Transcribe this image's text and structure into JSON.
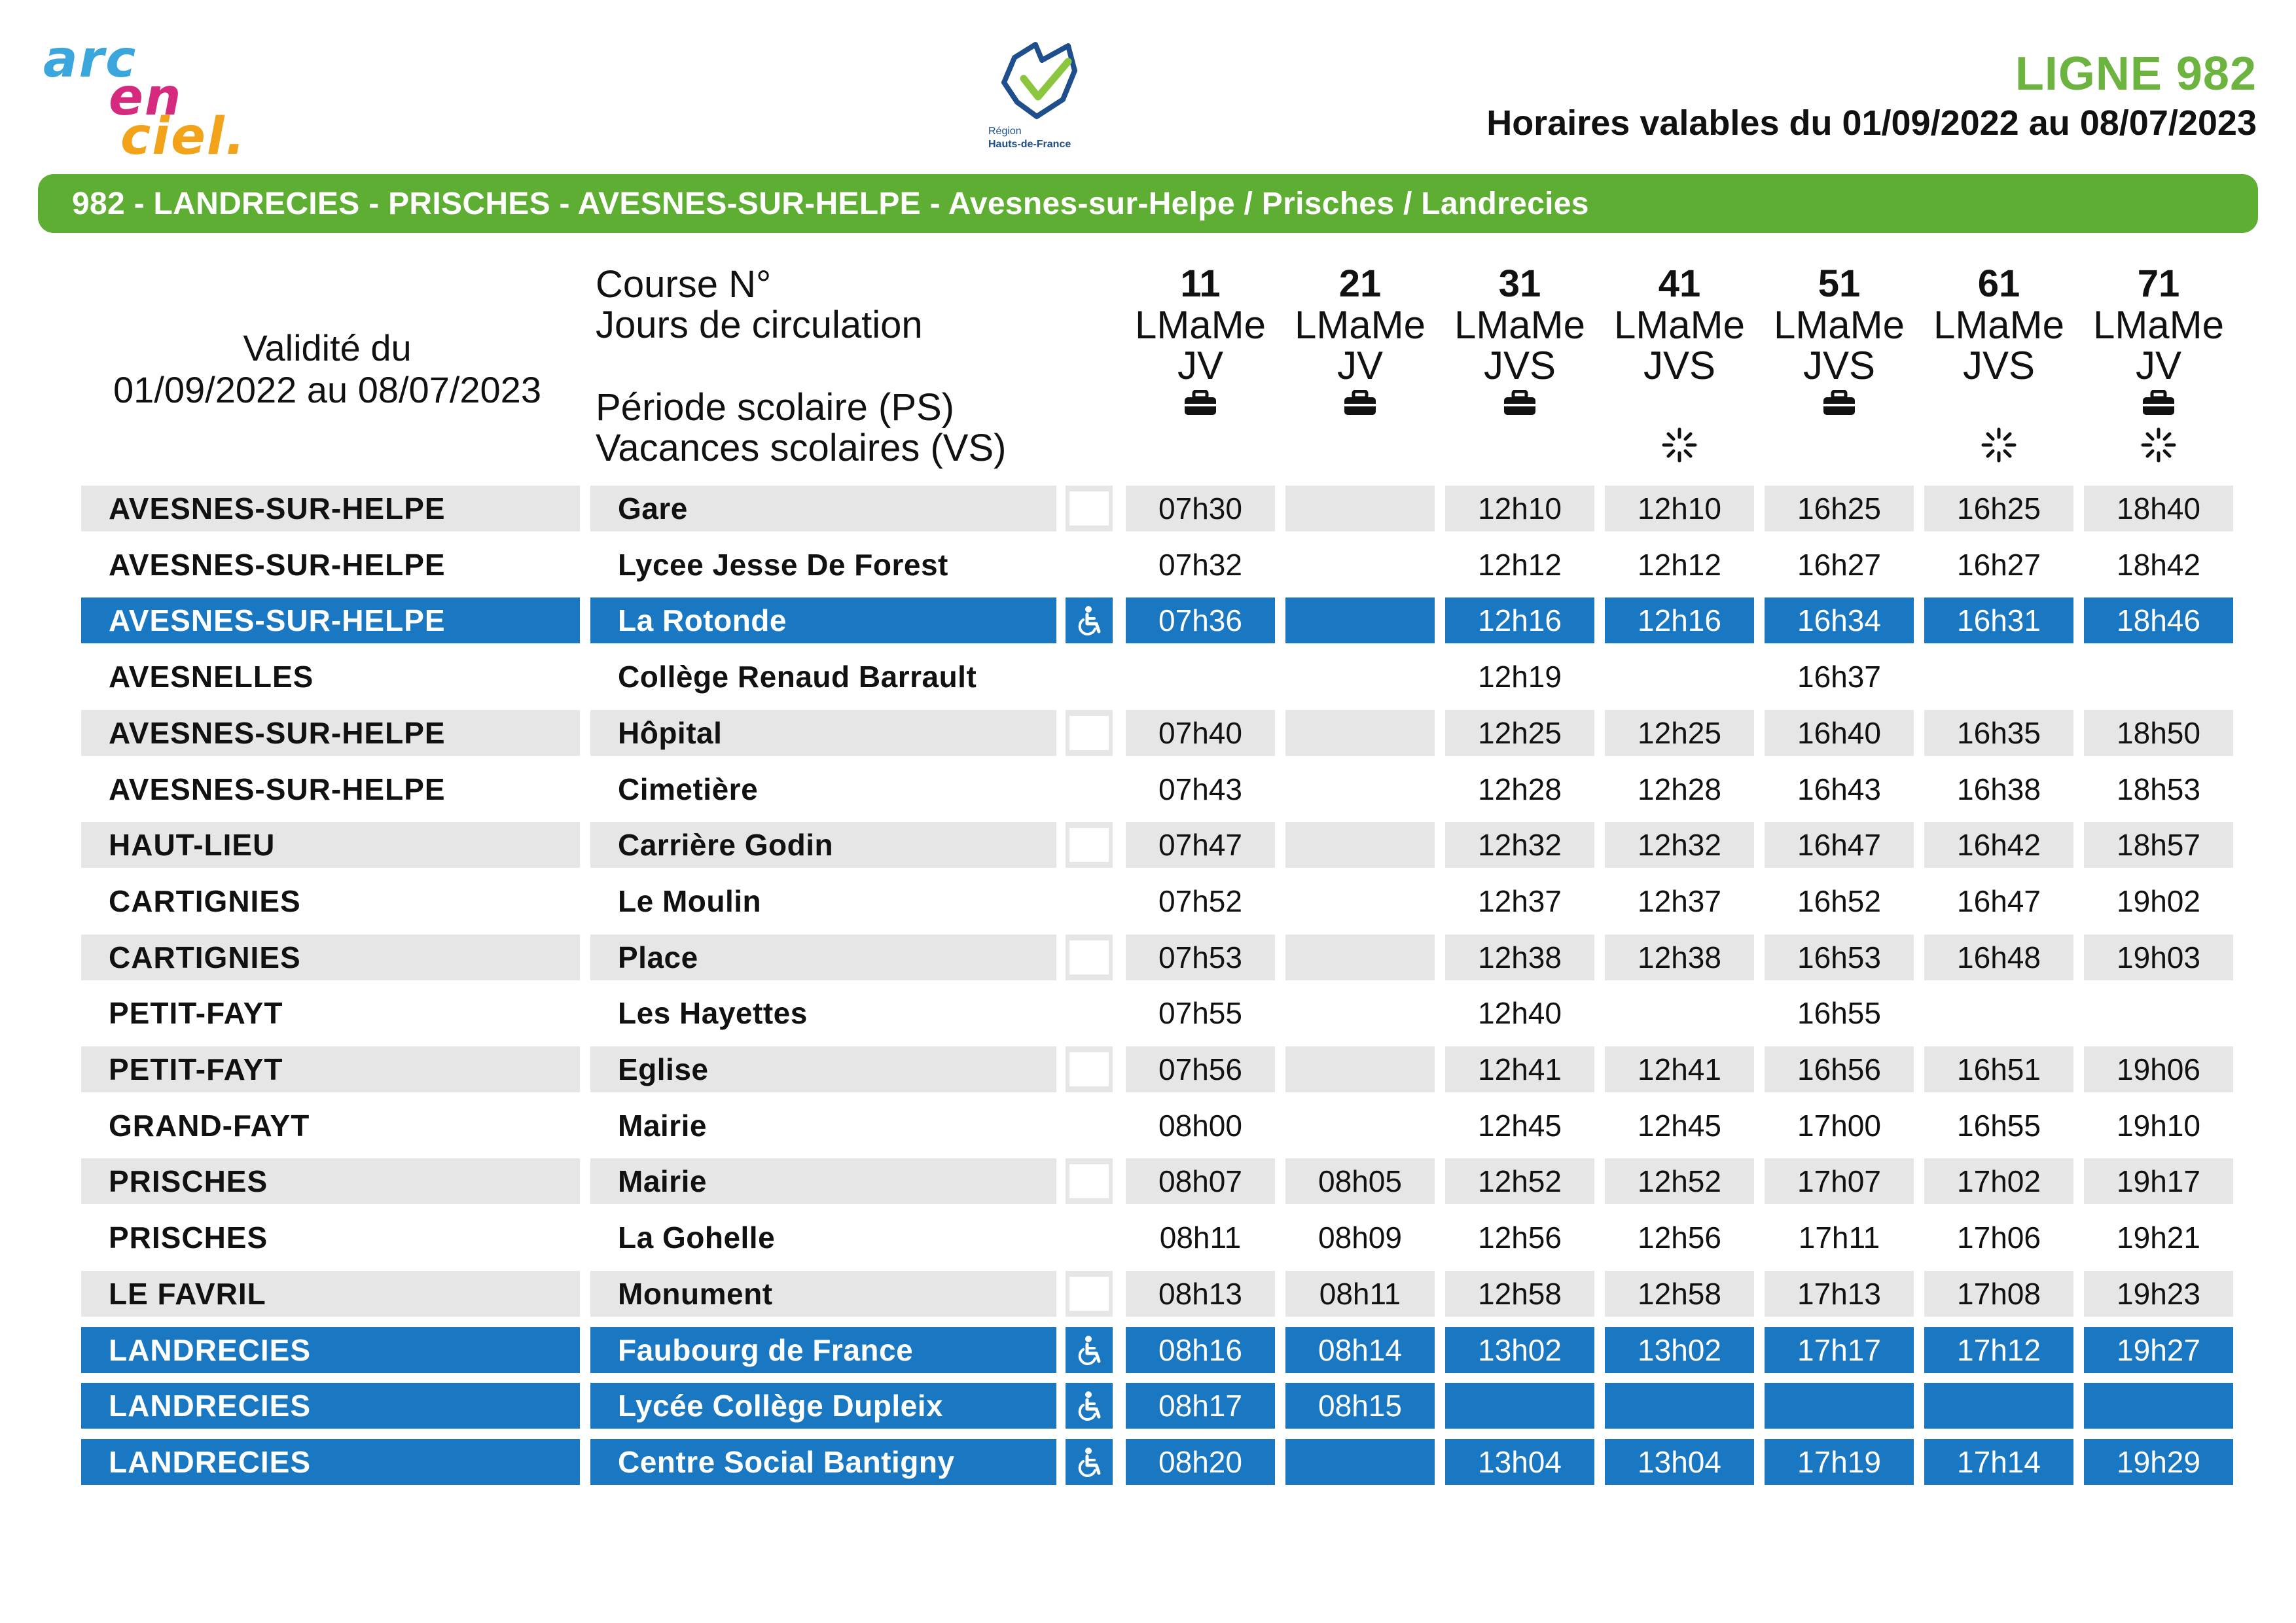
{
  "header": {
    "logo_words": [
      "arc",
      "en",
      "ciel."
    ],
    "region_caption": [
      "Région",
      "Hauts-de-France"
    ],
    "line_title": "LIGNE 982",
    "validity": "Horaires valables du 01/09/2022 au 08/07/2023",
    "route": "982 - LANDRECIES - PRISCHES - AVESNES-SUR-HELPE - Avesnes-sur-Helpe / Prisches / Landrecies"
  },
  "table_head": {
    "validity_line1": "Validité du",
    "validity_line2": "01/09/2022 au 08/07/2023",
    "course_label": "Course N°",
    "days_label": "Jours de circulation",
    "ps_label": "Période scolaire (PS)",
    "vs_label": "Vacances scolaires (VS)"
  },
  "courses": [
    {
      "num": "11",
      "days1": "LMaMe",
      "days2": "JV",
      "ps": true,
      "vs": false
    },
    {
      "num": "21",
      "days1": "LMaMe",
      "days2": "JV",
      "ps": true,
      "vs": false
    },
    {
      "num": "31",
      "days1": "LMaMe",
      "days2": "JVS",
      "ps": true,
      "vs": false
    },
    {
      "num": "41",
      "days1": "LMaMe",
      "days2": "JVS",
      "ps": false,
      "vs": true
    },
    {
      "num": "51",
      "days1": "LMaMe",
      "days2": "JVS",
      "ps": true,
      "vs": false
    },
    {
      "num": "61",
      "days1": "LMaMe",
      "days2": "JVS",
      "ps": false,
      "vs": true
    },
    {
      "num": "71",
      "days1": "LMaMe",
      "days2": "JV",
      "ps": true,
      "vs": true
    }
  ],
  "rows": [
    {
      "city": "AVESNES-SUR-HELPE",
      "stop": "Gare",
      "style": "gray",
      "accessible": false,
      "times": [
        "07h30",
        "",
        "12h10",
        "12h10",
        "16h25",
        "16h25",
        "18h40"
      ]
    },
    {
      "city": "AVESNES-SUR-HELPE",
      "stop": "Lycee Jesse De Forest",
      "style": "white",
      "accessible": false,
      "times": [
        "07h32",
        "",
        "12h12",
        "12h12",
        "16h27",
        "16h27",
        "18h42"
      ]
    },
    {
      "city": "AVESNES-SUR-HELPE",
      "stop": "La Rotonde",
      "style": "blue",
      "accessible": true,
      "times": [
        "07h36",
        "",
        "12h16",
        "12h16",
        "16h34",
        "16h31",
        "18h46"
      ]
    },
    {
      "city": "AVESNELLES",
      "stop": "Collège Renaud Barrault",
      "style": "white",
      "accessible": false,
      "times": [
        "",
        "",
        "12h19",
        "",
        "16h37",
        "",
        ""
      ]
    },
    {
      "city": "AVESNES-SUR-HELPE",
      "stop": "Hôpital",
      "style": "gray",
      "accessible": false,
      "times": [
        "07h40",
        "",
        "12h25",
        "12h25",
        "16h40",
        "16h35",
        "18h50"
      ]
    },
    {
      "city": "AVESNES-SUR-HELPE",
      "stop": "Cimetière",
      "style": "white",
      "accessible": false,
      "times": [
        "07h43",
        "",
        "12h28",
        "12h28",
        "16h43",
        "16h38",
        "18h53"
      ]
    },
    {
      "city": "HAUT-LIEU",
      "stop": "Carrière Godin",
      "style": "gray",
      "accessible": false,
      "times": [
        "07h47",
        "",
        "12h32",
        "12h32",
        "16h47",
        "16h42",
        "18h57"
      ]
    },
    {
      "city": "CARTIGNIES",
      "stop": "Le Moulin",
      "style": "white",
      "accessible": false,
      "times": [
        "07h52",
        "",
        "12h37",
        "12h37",
        "16h52",
        "16h47",
        "19h02"
      ]
    },
    {
      "city": "CARTIGNIES",
      "stop": "Place",
      "style": "gray",
      "accessible": false,
      "times": [
        "07h53",
        "",
        "12h38",
        "12h38",
        "16h53",
        "16h48",
        "19h03"
      ]
    },
    {
      "city": "PETIT-FAYT",
      "stop": "Les Hayettes",
      "style": "white",
      "accessible": false,
      "times": [
        "07h55",
        "",
        "12h40",
        "",
        "16h55",
        "",
        ""
      ]
    },
    {
      "city": "PETIT-FAYT",
      "stop": "Eglise",
      "style": "gray",
      "accessible": false,
      "times": [
        "07h56",
        "",
        "12h41",
        "12h41",
        "16h56",
        "16h51",
        "19h06"
      ]
    },
    {
      "city": "GRAND-FAYT",
      "stop": "Mairie",
      "style": "white",
      "accessible": false,
      "times": [
        "08h00",
        "",
        "12h45",
        "12h45",
        "17h00",
        "16h55",
        "19h10"
      ]
    },
    {
      "city": "PRISCHES",
      "stop": "Mairie",
      "style": "gray",
      "accessible": false,
      "times": [
        "08h07",
        "08h05",
        "12h52",
        "12h52",
        "17h07",
        "17h02",
        "19h17"
      ]
    },
    {
      "city": "PRISCHES",
      "stop": "La Gohelle",
      "style": "white",
      "accessible": false,
      "times": [
        "08h11",
        "08h09",
        "12h56",
        "12h56",
        "17h11",
        "17h06",
        "19h21"
      ]
    },
    {
      "city": "LE FAVRIL",
      "stop": "Monument",
      "style": "gray",
      "accessible": false,
      "times": [
        "08h13",
        "08h11",
        "12h58",
        "12h58",
        "17h13",
        "17h08",
        "19h23"
      ]
    },
    {
      "city": "LANDRECIES",
      "stop": "Faubourg de France",
      "style": "blue",
      "accessible": true,
      "times": [
        "08h16",
        "08h14",
        "13h02",
        "13h02",
        "17h17",
        "17h12",
        "19h27"
      ]
    },
    {
      "city": "LANDRECIES",
      "stop": "Lycée Collège Dupleix",
      "style": "blue",
      "accessible": true,
      "times": [
        "08h17",
        "08h15",
        "",
        "",
        "",
        "",
        ""
      ]
    },
    {
      "city": "LANDRECIES",
      "stop": "Centre Social Bantigny",
      "style": "blue",
      "accessible": true,
      "times": [
        "08h20",
        "",
        "13h04",
        "13h04",
        "17h19",
        "17h14",
        "19h29"
      ]
    }
  ]
}
